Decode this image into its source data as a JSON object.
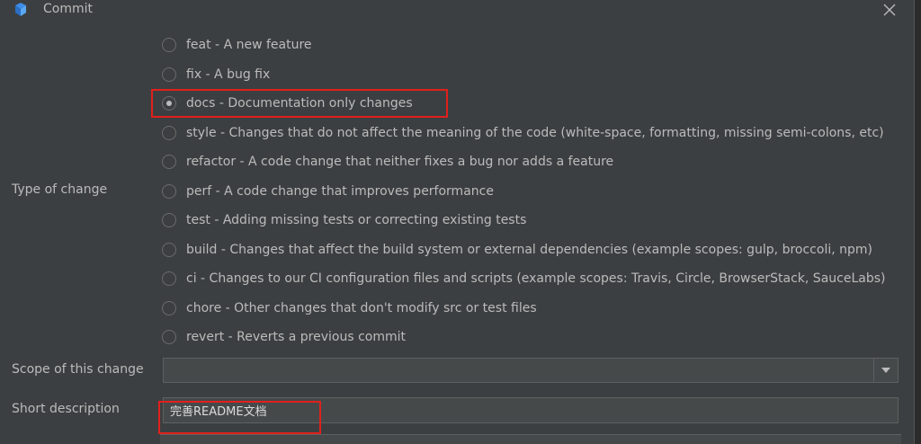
{
  "window": {
    "title": "Commit",
    "close_icon": "close-icon",
    "logo_icon": "app-logo-icon"
  },
  "type_of_change": {
    "label": "Type of change",
    "selected": "docs",
    "options": [
      {
        "id": "feat",
        "label": "feat - A new feature"
      },
      {
        "id": "fix",
        "label": "fix - A bug fix"
      },
      {
        "id": "docs",
        "label": "docs - Documentation only changes"
      },
      {
        "id": "style",
        "label": "style - Changes that do not affect the meaning of the code (white-space, formatting, missing semi-colons, etc)"
      },
      {
        "id": "refactor",
        "label": "refactor - A code change that neither fixes a bug nor adds a feature"
      },
      {
        "id": "perf",
        "label": "perf - A code change that improves performance"
      },
      {
        "id": "test",
        "label": "test - Adding missing tests or correcting existing tests"
      },
      {
        "id": "build",
        "label": "build - Changes that affect the build system or external dependencies (example scopes: gulp, broccoli, npm)"
      },
      {
        "id": "ci",
        "label": "ci - Changes to our CI configuration files and scripts (example scopes: Travis, Circle, BrowserStack, SauceLabs)"
      },
      {
        "id": "chore",
        "label": "chore - Other changes that don't modify src or test files"
      },
      {
        "id": "revert",
        "label": "revert - Reverts a previous commit"
      }
    ]
  },
  "scope": {
    "label": "Scope of this change",
    "value": ""
  },
  "short_description": {
    "label": "Short description",
    "value": "完善README文档"
  },
  "colors": {
    "background": "#3c3f41",
    "text": "#bbbbbb",
    "highlight": "#e0201c"
  }
}
